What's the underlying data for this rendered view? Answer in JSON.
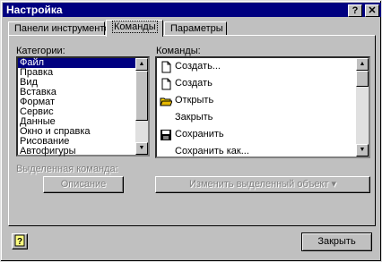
{
  "window": {
    "title": "Настройка",
    "help_label": "?",
    "close_label": "✕"
  },
  "tabs": [
    {
      "label": "Панели инструментов"
    },
    {
      "label": "Команды"
    },
    {
      "label": "Параметры"
    }
  ],
  "categories": {
    "caption": "Категории:",
    "items": [
      "Файл",
      "Правка",
      "Вид",
      "Вставка",
      "Формат",
      "Сервис",
      "Данные",
      "Окно и справка",
      "Рисование",
      "Автофигуры"
    ],
    "selected": "Файл"
  },
  "commands": {
    "caption": "Команды:",
    "items": [
      {
        "label": "Создать...",
        "icon": "new-document-icon"
      },
      {
        "label": "Создать",
        "icon": "new-document-icon"
      },
      {
        "label": "Открыть",
        "icon": "open-folder-icon"
      },
      {
        "label": "Закрыть",
        "icon": ""
      },
      {
        "label": "Сохранить",
        "icon": "save-disk-icon"
      },
      {
        "label": "Сохранить как...",
        "icon": ""
      }
    ]
  },
  "selected_command": {
    "caption": "Выделенная команда:",
    "description_button": "Описание",
    "modify_button": "Изменить выделенный объект ▾"
  },
  "footer": {
    "close_button": "Закрыть"
  },
  "colors": {
    "titlebar": "#000080",
    "selection": "#000080",
    "face": "#c0c0c0"
  }
}
